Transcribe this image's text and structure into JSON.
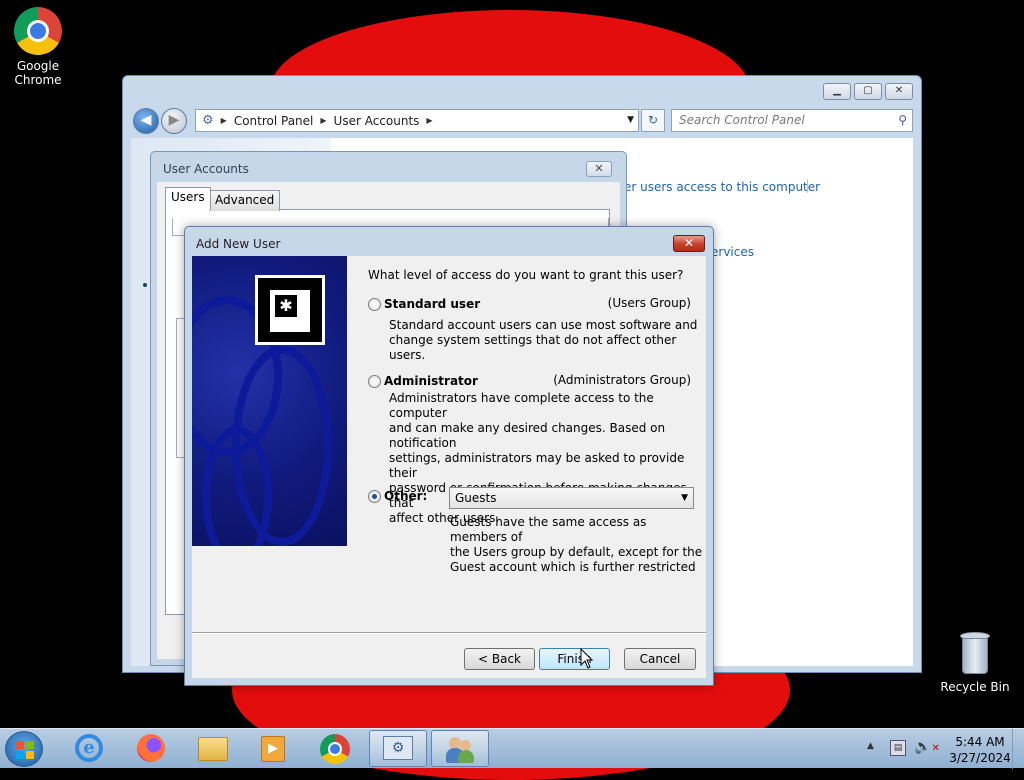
{
  "desktop": {
    "icons": [
      {
        "label": "Google Chrome",
        "icon": "chrome-icon"
      },
      {
        "label": "Recycle Bin",
        "icon": "recycle-bin-icon"
      }
    ]
  },
  "control_panel": {
    "breadcrumb": [
      "Control Panel",
      "User Accounts"
    ],
    "search_placeholder": "Search Control Panel",
    "links": [
      "er users access to this computer",
      "ervices"
    ]
  },
  "user_accounts_dialog": {
    "title": "User Accounts",
    "tabs": [
      "Users",
      "Advanced"
    ]
  },
  "add_new_user": {
    "title": "Add New User",
    "question": "What level of access do you want to grant this user?",
    "options": [
      {
        "label": "Standard user",
        "group": "(Users Group)",
        "description": [
          "Standard account users can use most software and",
          "change system settings that do not affect other users."
        ],
        "checked": false
      },
      {
        "label": "Administrator",
        "group": "(Administrators Group)",
        "description": [
          "Administrators have complete access to the computer",
          "and can make any desired changes. Based on notification",
          "settings, administrators may be asked to provide their",
          "password or confirmation before making changes that",
          "affect other users."
        ],
        "checked": false
      },
      {
        "label": "Other:",
        "selected_group": "Guests",
        "description": [
          "Guests have the same access as members of",
          "the Users group by default, except for the",
          "Guest account which is further restricted"
        ],
        "checked": true
      }
    ],
    "buttons": {
      "back": "< Back",
      "finish": "Finish",
      "cancel": "Cancel"
    }
  },
  "taskbar": {
    "pinned": [
      "internet-explorer-icon",
      "firefox-icon",
      "file-explorer-icon",
      "media-player-icon",
      "chrome-icon",
      "control-panel-icon",
      "user-accounts-icon"
    ],
    "time": "5:44 AM",
    "date": "3/27/2024"
  }
}
